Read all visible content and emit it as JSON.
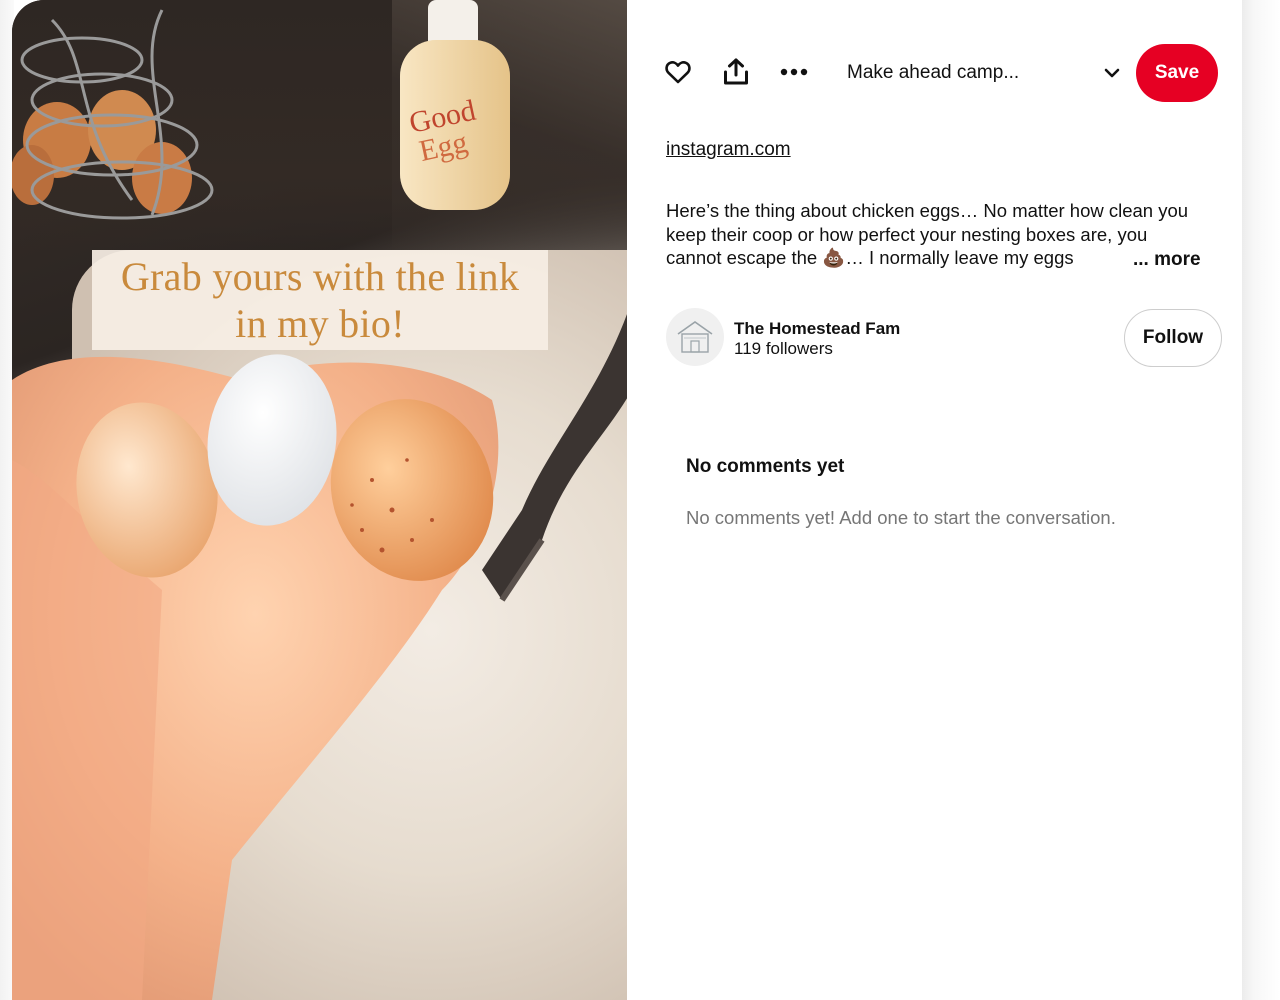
{
  "pin": {
    "overlay_text": "Grab yours with the link in my bio!"
  },
  "toolbar": {
    "like_icon": "heart-icon",
    "share_icon": "share-icon",
    "more_icon": "more-options-icon",
    "board_name": "Make ahead camp...",
    "board_dropdown_icon": "chevron-down-icon",
    "save_label": "Save",
    "save_color": "#e60023"
  },
  "source": {
    "link_text": "instagram.com"
  },
  "description": {
    "text": "Here’s the thing about chicken eggs… No matter how clean you keep their coop or how perfect your nesting boxes are, you cannot escape the 💩… I normally leave my eggs",
    "more_label": "... more"
  },
  "creator": {
    "name": "The Homestead Fam",
    "followers": "119 followers",
    "follow_label": "Follow"
  },
  "comments": {
    "title": "No comments yet",
    "empty_message": "No comments yet! Add one to start the conversation."
  }
}
